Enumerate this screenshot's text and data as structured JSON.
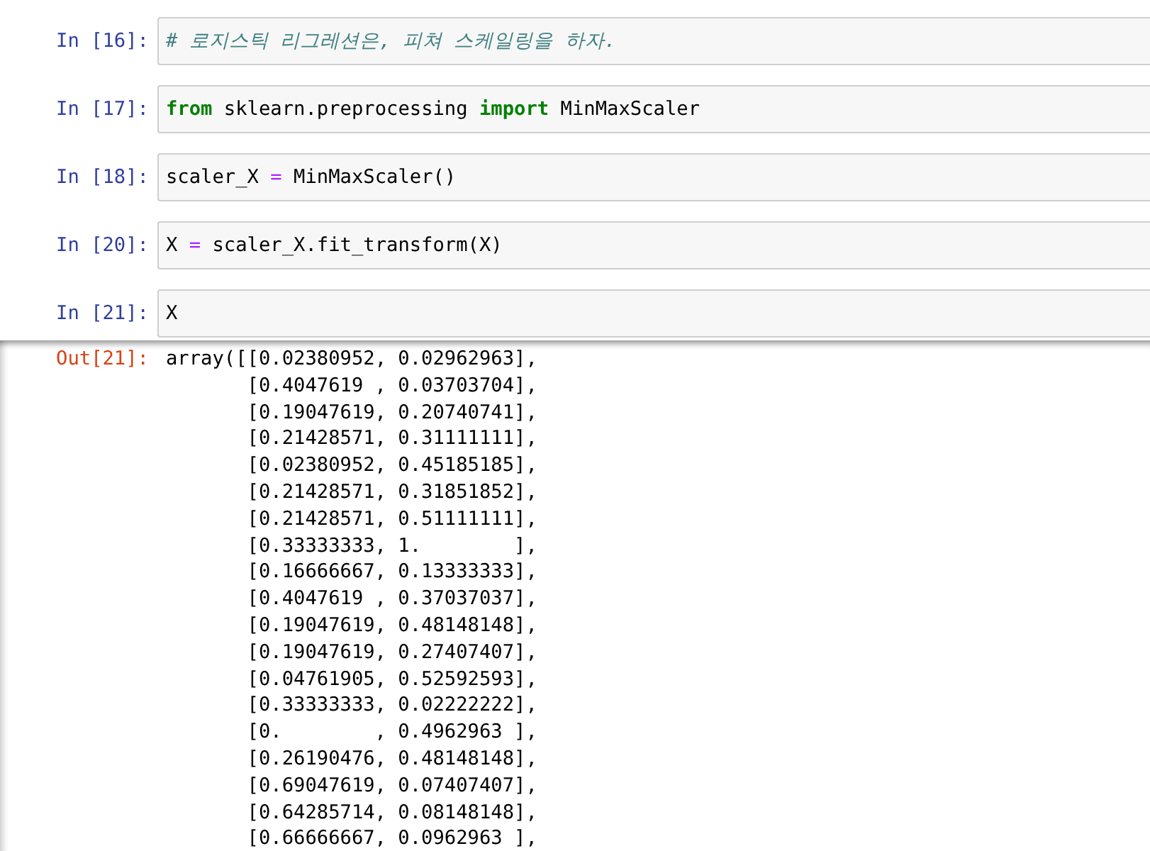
{
  "cells": [
    {
      "prompt": "In [16]:",
      "code": [
        {
          "kind": "comment",
          "text": "# 로지스틱 리그레션은, 피쳐 스케일링을 하자."
        }
      ]
    },
    {
      "prompt": "In [17]:",
      "code": [
        {
          "kind": "keyword",
          "text": "from"
        },
        {
          "kind": "plain",
          "text": " sklearn.preprocessing "
        },
        {
          "kind": "keyword",
          "text": "import"
        },
        {
          "kind": "plain",
          "text": " MinMaxScaler"
        }
      ]
    },
    {
      "prompt": "In [18]:",
      "code": [
        {
          "kind": "plain",
          "text": "scaler_X "
        },
        {
          "kind": "operator",
          "text": "="
        },
        {
          "kind": "plain",
          "text": " MinMaxScaler()"
        }
      ]
    },
    {
      "prompt": "In [20]:",
      "code": [
        {
          "kind": "plain",
          "text": "X "
        },
        {
          "kind": "operator",
          "text": "="
        },
        {
          "kind": "plain",
          "text": " scaler_X.fit_transform(X)"
        }
      ]
    },
    {
      "prompt": "In [21]:",
      "code": [
        {
          "kind": "plain",
          "text": "X"
        }
      ]
    }
  ],
  "output": {
    "prompt": "Out[21]:",
    "lines": [
      "array([[0.02380952, 0.02962963],",
      "[0.4047619 , 0.03703704],",
      "[0.19047619, 0.20740741],",
      "[0.21428571, 0.31111111],",
      "[0.02380952, 0.45185185],",
      "[0.21428571, 0.31851852],",
      "[0.21428571, 0.51111111],",
      "[0.33333333, 1.        ],",
      "[0.16666667, 0.13333333],",
      "[0.4047619 , 0.37037037],",
      "[0.19047619, 0.48148148],",
      "[0.19047619, 0.27407407],",
      "[0.04761905, 0.52592593],",
      "[0.33333333, 0.02222222],",
      "[0.        , 0.4962963 ],",
      "[0.26190476, 0.48148148],",
      "[0.69047619, 0.07407407],",
      "[0.64285714, 0.08148148],",
      "[0.66666667, 0.0962963 ],"
    ]
  }
}
